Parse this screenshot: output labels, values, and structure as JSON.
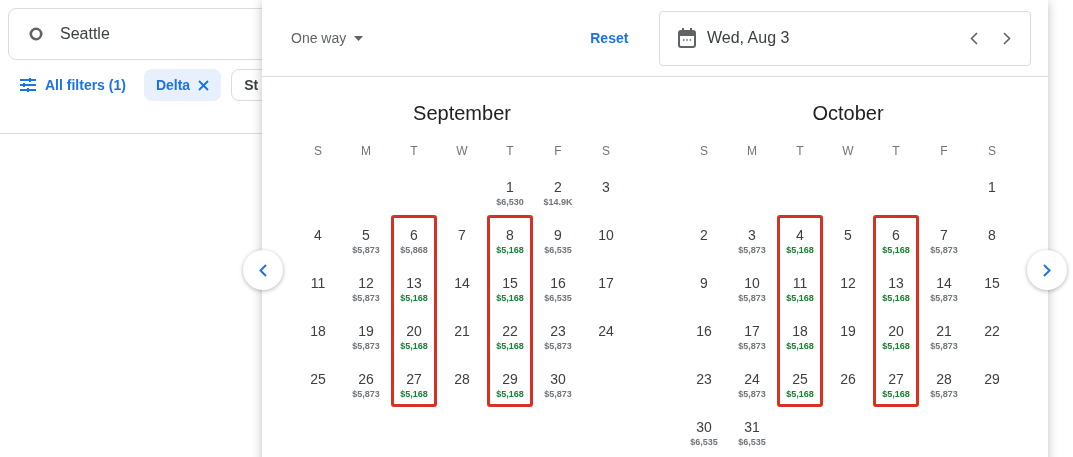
{
  "origin_field": {
    "value": "Seattle"
  },
  "filters": {
    "all_filters": "All filters (1)",
    "chips": [
      {
        "label": "Delta",
        "selected": true,
        "removable": true
      },
      {
        "label": "St",
        "selected": false,
        "removable": false
      }
    ]
  },
  "date_picker": {
    "trip_type": "One way",
    "reset": "Reset",
    "date_field": {
      "value": "Wed, Aug 3"
    },
    "months": [
      {
        "name": "September",
        "weekdays": [
          "S",
          "M",
          "T",
          "W",
          "T",
          "F",
          "S"
        ],
        "weeks": [
          [
            {
              "day": "1",
              "price": "$6,530",
              "color": "#70757a",
              "highlighted": false
            },
            {
              "day": "2",
              "price": "$14.9K",
              "color": "#70757a",
              "highlighted": false
            },
            {
              "day": "3",
              "highlighted": false
            }
          ],
          [
            {
              "day": "4",
              "highlighted": false
            },
            {
              "day": "5",
              "price": "$5,873",
              "color": "#70757a",
              "highlighted": false
            },
            {
              "day": "6",
              "price": "$5,868",
              "color": "#70757a",
              "highlighted": true
            },
            {
              "day": "7",
              "highlighted": false
            },
            {
              "day": "8",
              "price": "$5,168",
              "color": "#188038",
              "highlighted": true
            },
            {
              "day": "9",
              "price": "$6,535",
              "color": "#70757a",
              "highlighted": false
            },
            {
              "day": "10",
              "highlighted": false
            }
          ],
          [
            {
              "day": "11",
              "highlighted": false
            },
            {
              "day": "12",
              "price": "$5,873",
              "color": "#70757a",
              "highlighted": false
            },
            {
              "day": "13",
              "price": "$5,168",
              "color": "#188038",
              "highlighted": true
            },
            {
              "day": "14",
              "highlighted": false
            },
            {
              "day": "15",
              "price": "$5,168",
              "color": "#188038",
              "highlighted": true
            },
            {
              "day": "16",
              "price": "$6,535",
              "color": "#70757a",
              "highlighted": false
            },
            {
              "day": "17",
              "highlighted": false
            }
          ],
          [
            {
              "day": "18",
              "highlighted": false
            },
            {
              "day": "19",
              "price": "$5,873",
              "color": "#70757a",
              "highlighted": false
            },
            {
              "day": "20",
              "price": "$5,168",
              "color": "#188038",
              "highlighted": true
            },
            {
              "day": "21",
              "highlighted": false
            },
            {
              "day": "22",
              "price": "$5,168",
              "color": "#188038",
              "highlighted": true
            },
            {
              "day": "23",
              "price": "$5,873",
              "color": "#70757a",
              "highlighted": false
            },
            {
              "day": "24",
              "highlighted": false
            }
          ],
          [
            {
              "day": "25",
              "highlighted": false
            },
            {
              "day": "26",
              "price": "$5,873",
              "color": "#70757a",
              "highlighted": false
            },
            {
              "day": "27",
              "price": "$5,168",
              "color": "#188038",
              "highlighted": true
            },
            {
              "day": "28",
              "highlighted": false
            },
            {
              "day": "29",
              "price": "$5,168",
              "color": "#188038",
              "highlighted": true
            },
            {
              "day": "30",
              "price": "$5,873",
              "color": "#70757a",
              "highlighted": false
            }
          ]
        ]
      },
      {
        "name": "October",
        "weekdays": [
          "S",
          "M",
          "T",
          "W",
          "T",
          "F",
          "S"
        ],
        "weeks": [
          [
            {
              "day": "1",
              "highlighted": false
            }
          ],
          [
            {
              "day": "2",
              "highlighted": false
            },
            {
              "day": "3",
              "price": "$5,873",
              "color": "#70757a",
              "highlighted": false
            },
            {
              "day": "4",
              "price": "$5,168",
              "color": "#188038",
              "highlighted": true
            },
            {
              "day": "5",
              "highlighted": false
            },
            {
              "day": "6",
              "price": "$5,168",
              "color": "#188038",
              "highlighted": true
            },
            {
              "day": "7",
              "price": "$5,873",
              "color": "#70757a",
              "highlighted": false
            },
            {
              "day": "8",
              "highlighted": false
            }
          ],
          [
            {
              "day": "9",
              "highlighted": false
            },
            {
              "day": "10",
              "price": "$5,873",
              "color": "#70757a",
              "highlighted": false
            },
            {
              "day": "11",
              "price": "$5,168",
              "color": "#188038",
              "highlighted": true
            },
            {
              "day": "12",
              "highlighted": false
            },
            {
              "day": "13",
              "price": "$5,168",
              "color": "#188038",
              "highlighted": true
            },
            {
              "day": "14",
              "price": "$5,873",
              "color": "#70757a",
              "highlighted": false
            },
            {
              "day": "15",
              "highlighted": false
            }
          ],
          [
            {
              "day": "16",
              "highlighted": false
            },
            {
              "day": "17",
              "price": "$5,873",
              "color": "#70757a",
              "highlighted": false
            },
            {
              "day": "18",
              "price": "$5,168",
              "color": "#188038",
              "highlighted": true
            },
            {
              "day": "19",
              "highlighted": false
            },
            {
              "day": "20",
              "price": "$5,168",
              "color": "#188038",
              "highlighted": true
            },
            {
              "day": "21",
              "price": "$5,873",
              "color": "#70757a",
              "highlighted": false
            },
            {
              "day": "22",
              "highlighted": false
            }
          ],
          [
            {
              "day": "23",
              "highlighted": false
            },
            {
              "day": "24",
              "price": "$5,873",
              "color": "#70757a",
              "highlighted": false
            },
            {
              "day": "25",
              "price": "$5,168",
              "color": "#188038",
              "highlighted": true
            },
            {
              "day": "26",
              "highlighted": false
            },
            {
              "day": "27",
              "price": "$5,168",
              "color": "#188038",
              "highlighted": true
            },
            {
              "day": "28",
              "price": "$5,873",
              "color": "#70757a",
              "highlighted": false
            },
            {
              "day": "29",
              "highlighted": false
            }
          ],
          [
            {
              "day": "30",
              "price": "$6,535",
              "color": "#70757a",
              "highlighted": false
            },
            {
              "day": "31",
              "price": "$6,535",
              "color": "#70757a",
              "highlighted": false
            }
          ]
        ]
      }
    ]
  }
}
